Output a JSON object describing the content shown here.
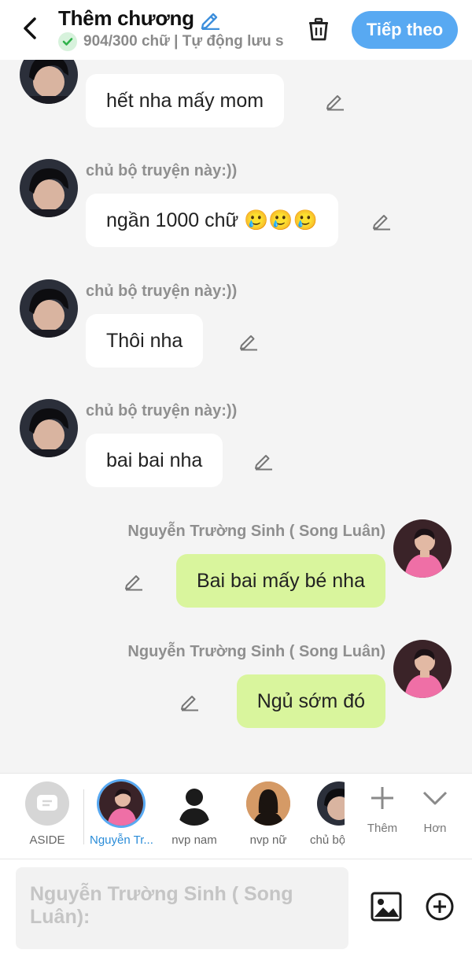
{
  "header": {
    "title": "Thêm chương",
    "word_status": "904/300 chữ | Tự động lưu s",
    "next_label": "Tiếp theo"
  },
  "messages": [
    {
      "side": "left",
      "sender": "chủ bộ truyện này:))",
      "text": "hết nha mấy mom"
    },
    {
      "side": "left",
      "sender": "chủ bộ truyện này:))",
      "text": "ngần 1000 chữ 🥲🥲🥲"
    },
    {
      "side": "left",
      "sender": "chủ bộ truyện này:))",
      "text": "Thôi nha"
    },
    {
      "side": "left",
      "sender": "chủ bộ truyện này:))",
      "text": "bai bai nha"
    },
    {
      "side": "right",
      "sender": "Nguyễn Trường Sinh ( Song Luân)",
      "text": "Bai bai mấy bé nha"
    },
    {
      "side": "right",
      "sender": "Nguyễn Trường Sinh ( Song Luân)",
      "text": "Ngủ sớm đó"
    }
  ],
  "characters": [
    {
      "label": "ASIDE",
      "icon": "aside-icon"
    },
    {
      "label": "Nguyễn Tr...",
      "icon": "avatar-photo",
      "selected": true
    },
    {
      "label": "nvp nam",
      "icon": "male-silhouette-icon"
    },
    {
      "label": "nvp nữ",
      "icon": "female-silhouette-icon"
    },
    {
      "label": "chủ bộ",
      "icon": "avatar-photo"
    }
  ],
  "tools": {
    "more_label": "Thêm",
    "collapse_label": "Hơn"
  },
  "input": {
    "placeholder": "Nguyễn Trường Sinh ( Song Luân):"
  },
  "colors": {
    "accent": "#58a9f2",
    "right_bubble": "#d9f59d",
    "left_bubble": "#ffffff",
    "background": "#f4f4f4"
  }
}
